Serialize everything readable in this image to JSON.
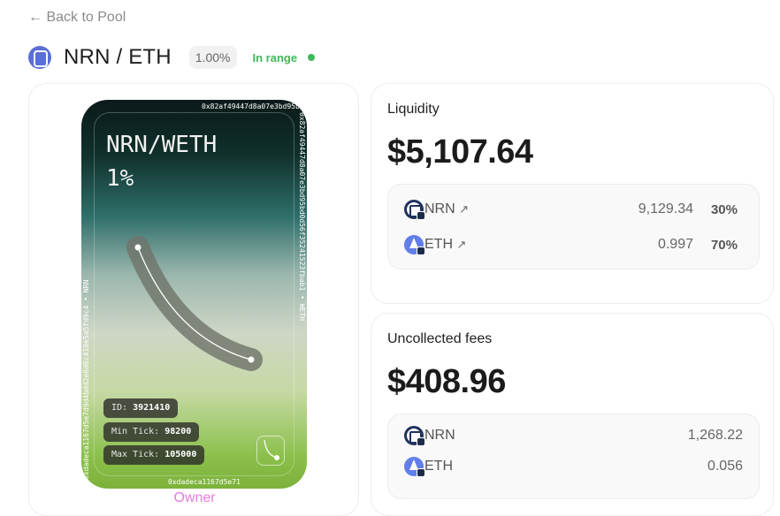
{
  "nav": {
    "back_label": "← Back to Pool"
  },
  "header": {
    "pair": "NRN / ETH",
    "fee_tier": "1.00%",
    "range_status": "In range",
    "status_color": "#3fb85c"
  },
  "nft": {
    "title": "NRN/WETH",
    "fee": "1%",
    "address_top": "0x82af49447d8a07e3bd95bd0d56f35241523fbab1",
    "address_right": "0x82af49447d8a07e3bd95bd0d56f35241523fbab1 • WETH",
    "address_left": "0xdadeca1167d5e7d9d4bdd2e6d6c410e5a5fd9c4 • NRN",
    "address_bottom": "0xdadeca1167d5e71",
    "id_label": "ID:",
    "id_value": "3921410",
    "min_tick_label": "Min Tick:",
    "min_tick_value": "98200",
    "max_tick_label": "Max Tick:",
    "max_tick_value": "105000",
    "role": "Owner"
  },
  "liquidity": {
    "label": "Liquidity",
    "amount": "$5,107.64",
    "tokens": [
      {
        "symbol": "NRN",
        "arrow": "↗",
        "amount": "9,129.34",
        "percent": "30%",
        "icon": "nrn-token-icon"
      },
      {
        "symbol": "ETH",
        "arrow": "↗",
        "amount": "0.997",
        "percent": "70%",
        "icon": "eth-token-icon"
      }
    ]
  },
  "fees": {
    "label": "Uncollected fees",
    "amount": "$408.96",
    "tokens": [
      {
        "symbol": "NRN",
        "amount": "1,268.22",
        "icon": "nrn-token-icon"
      },
      {
        "symbol": "ETH",
        "amount": "0.056",
        "icon": "eth-token-icon"
      }
    ]
  }
}
